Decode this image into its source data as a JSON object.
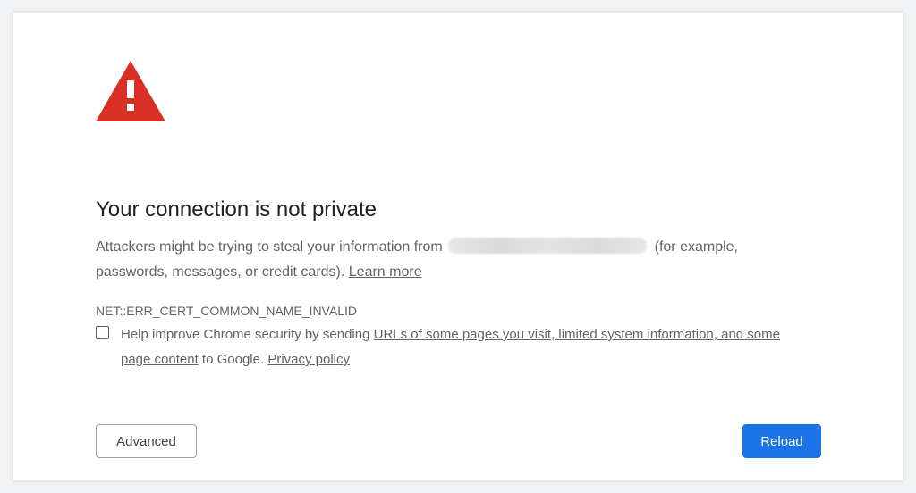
{
  "page": {
    "title": "Your connection is not private",
    "description_before": "Attackers might be trying to steal your information from",
    "description_after": "(for example, passwords, messages, or credit cards).",
    "learn_more": "Learn more",
    "error_code": "NET::ERR_CERT_COMMON_NAME_INVALID"
  },
  "optin": {
    "checked": false,
    "text_before": "Help improve Chrome security by sending",
    "link_text": "URLs of some pages you visit, limited system information, and some page content",
    "text_middle": "to Google.",
    "privacy_link": "Privacy policy"
  },
  "buttons": {
    "advanced": "Advanced",
    "reload": "Reload"
  },
  "colors": {
    "warning_red": "#d93025",
    "primary_blue": "#1a73e8",
    "text_gray": "#5f6368",
    "title_text": "#202124"
  },
  "icons": {
    "warning": "warning-triangle-icon"
  }
}
